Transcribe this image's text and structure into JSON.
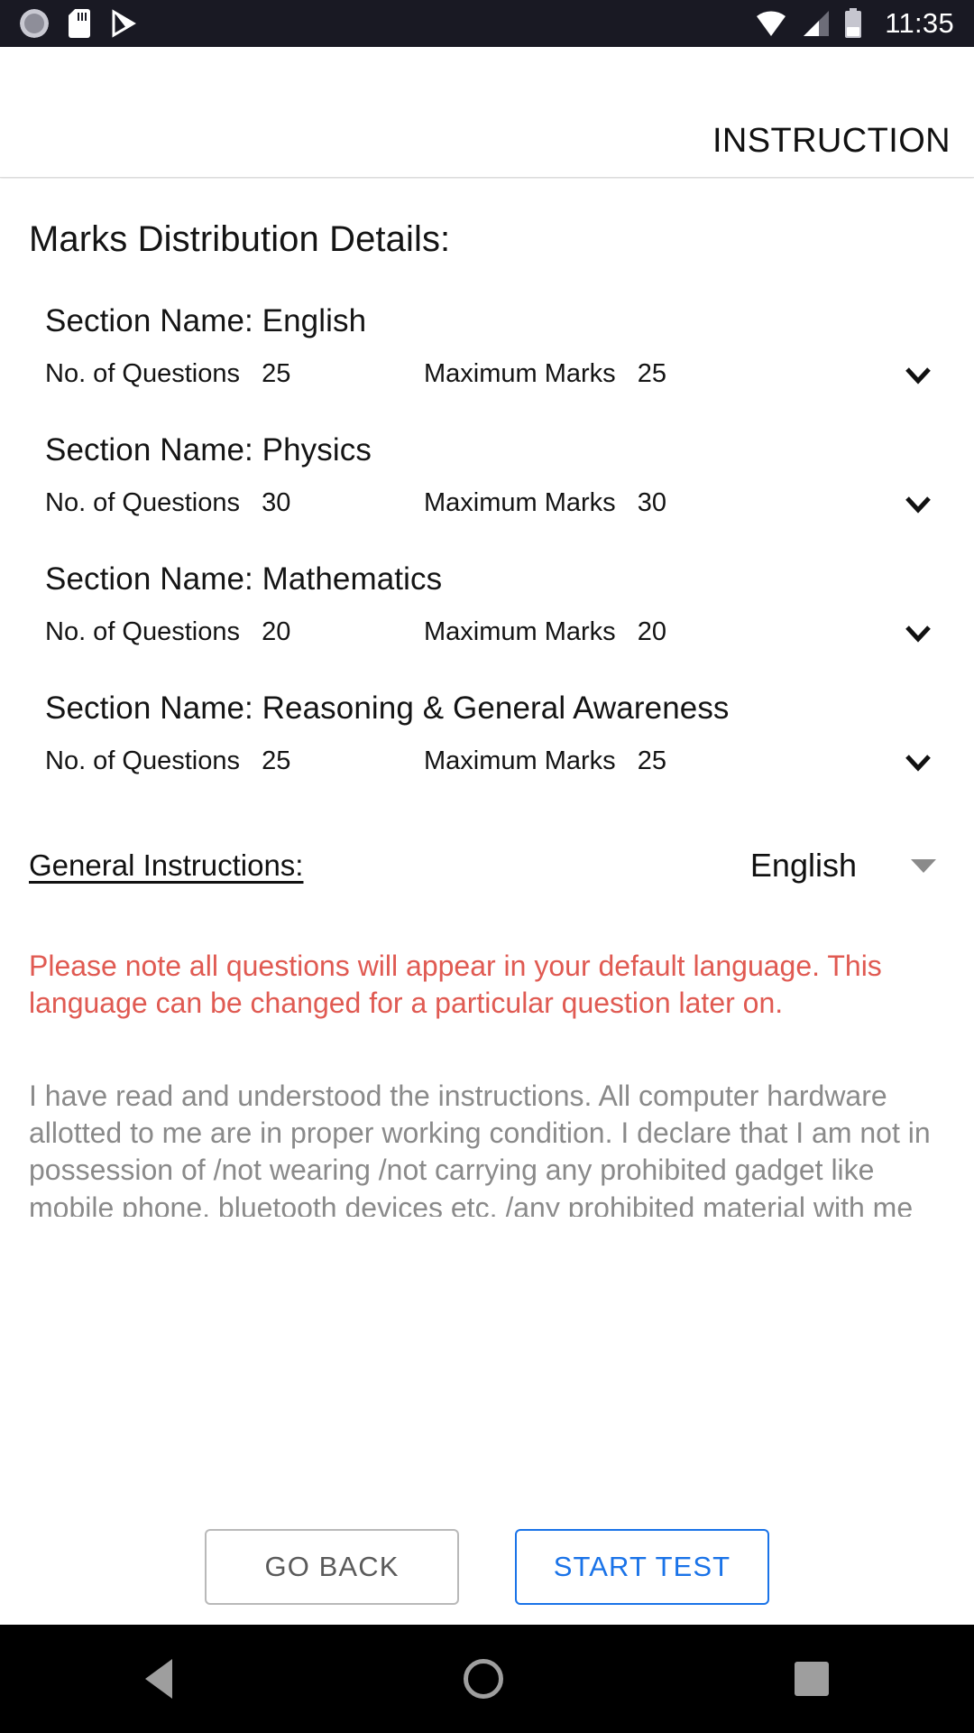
{
  "statusbar": {
    "time": "11:35",
    "icons": [
      "sync-icon",
      "sd-card-icon",
      "play-store-icon",
      "wifi-icon",
      "cellular-signal-icon",
      "battery-icon"
    ]
  },
  "appbar": {
    "title": "INSTRUCTION"
  },
  "main": {
    "page_title": "Marks Distribution Details:",
    "questions_label": "No. of Questions",
    "marks_label": "Maximum Marks",
    "sections": [
      {
        "name": "Section Name: English",
        "questions": "25",
        "marks": "25"
      },
      {
        "name": "Section Name: Physics",
        "questions": "30",
        "marks": "30"
      },
      {
        "name": "Section Name: Mathematics",
        "questions": "20",
        "marks": "20"
      },
      {
        "name": "Section Name: Reasoning & General Awareness",
        "questions": "25",
        "marks": "25"
      }
    ],
    "general_instructions_label": "General Instructions:",
    "language_selected": "English",
    "note_text": "Please note all questions will appear in your default language. This language can be changed for a particular question later on.",
    "declaration_text": "I have read and understood the instructions. All computer hardware allotted to me are in proper working condition. I declare that I am not in possession of /not wearing /not carrying any prohibited gadget like mobile phone, bluetooth devices etc. /any prohibited material with me into the"
  },
  "buttons": {
    "go_back": "GO BACK",
    "start_test": "START TEST"
  },
  "colors": {
    "accent_blue": "#1a73e8",
    "note_red": "#e05a52",
    "declaration_gray": "#8a8a8a",
    "statusbar_bg": "#191923"
  },
  "navbar": {
    "items": [
      "back-nav-icon",
      "home-nav-icon",
      "recents-nav-icon"
    ]
  }
}
